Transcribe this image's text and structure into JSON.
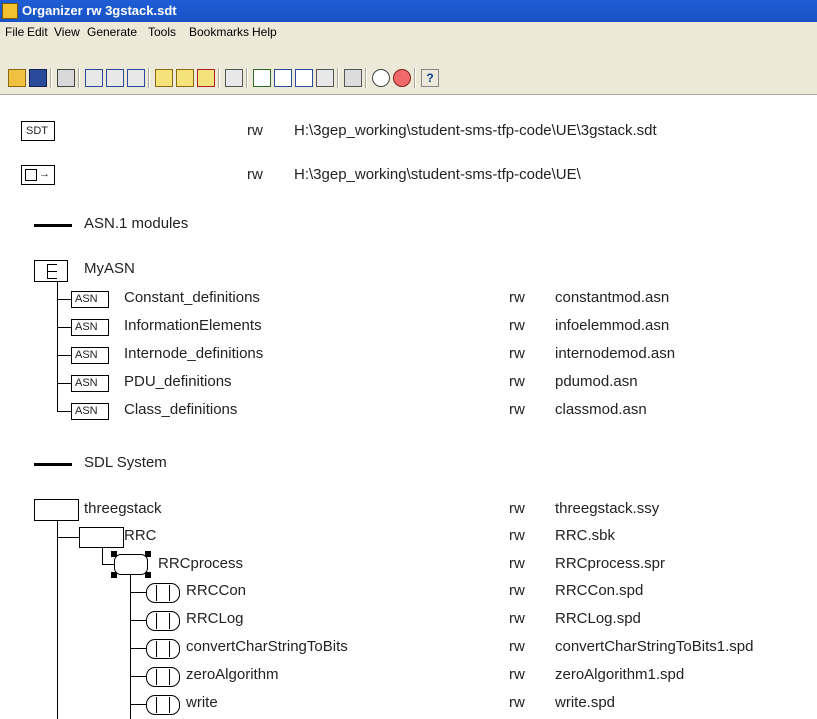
{
  "window": {
    "title": "Organizer rw 3gstack.sdt"
  },
  "menu": [
    "File",
    "Edit",
    "View",
    "Generate",
    "Tools",
    "Bookmarks",
    "Help"
  ],
  "toolbar": {
    "help_label": "?",
    "icons": [
      "open-icon",
      "save-icon",
      "print-icon",
      "symbol-icon",
      "dependencies-icon",
      "edit-icon",
      "analyze-icon",
      "make-icon",
      "simulator-icon",
      "binoculars-icon",
      "add-icon",
      "down-icon",
      "up-icon",
      "connect-icon",
      "window-icon",
      "zoom-out-icon",
      "zoom-in-icon",
      "help-icon"
    ]
  },
  "header_rows": [
    {
      "icon_label": "SDT",
      "access": "rw",
      "path": "H:\\3gep_working\\student-sms-tfp-code\\UE\\3gstack.sdt"
    },
    {
      "icon_label": "→",
      "access": "rw",
      "path": "H:\\3gep_working\\student-sms-tfp-code\\UE\\"
    }
  ],
  "asn_chapter": {
    "title": "ASN.1 modules"
  },
  "asn_group": {
    "label": "MyASN"
  },
  "asn_modules": [
    {
      "name": "Constant_definitions",
      "access": "rw",
      "file": "constantmod.asn"
    },
    {
      "name": "InformationElements",
      "access": "rw",
      "file": "infoelemmod.asn"
    },
    {
      "name": "Internode_definitions",
      "access": "rw",
      "file": "internodemod.asn"
    },
    {
      "name": "PDU_definitions",
      "access": "rw",
      "file": "pdumod.asn"
    },
    {
      "name": "Class_definitions",
      "access": "rw",
      "file": "classmod.asn"
    }
  ],
  "asn_badge": "ASN",
  "sdl_chapter": {
    "title": "SDL System"
  },
  "sdl_system": {
    "name": "threegstack",
    "access": "rw",
    "file": "threegstack.ssy"
  },
  "sdl_block": {
    "name": "RRC",
    "access": "rw",
    "file": "RRC.sbk"
  },
  "sdl_process": {
    "name": "RRCprocess",
    "access": "rw",
    "file": "RRCprocess.spr"
  },
  "sdl_procedures": [
    {
      "name": "RRCCon",
      "access": "rw",
      "file": "RRCCon.spd"
    },
    {
      "name": "RRCLog",
      "access": "rw",
      "file": "RRCLog.spd"
    },
    {
      "name": "convertCharStringToBits",
      "access": "rw",
      "file": "convertCharStringToBits1.spd"
    },
    {
      "name": "zeroAlgorithm",
      "access": "rw",
      "file": "zeroAlgorithm1.spd"
    },
    {
      "name": "write",
      "access": "rw",
      "file": "write.spd"
    }
  ]
}
